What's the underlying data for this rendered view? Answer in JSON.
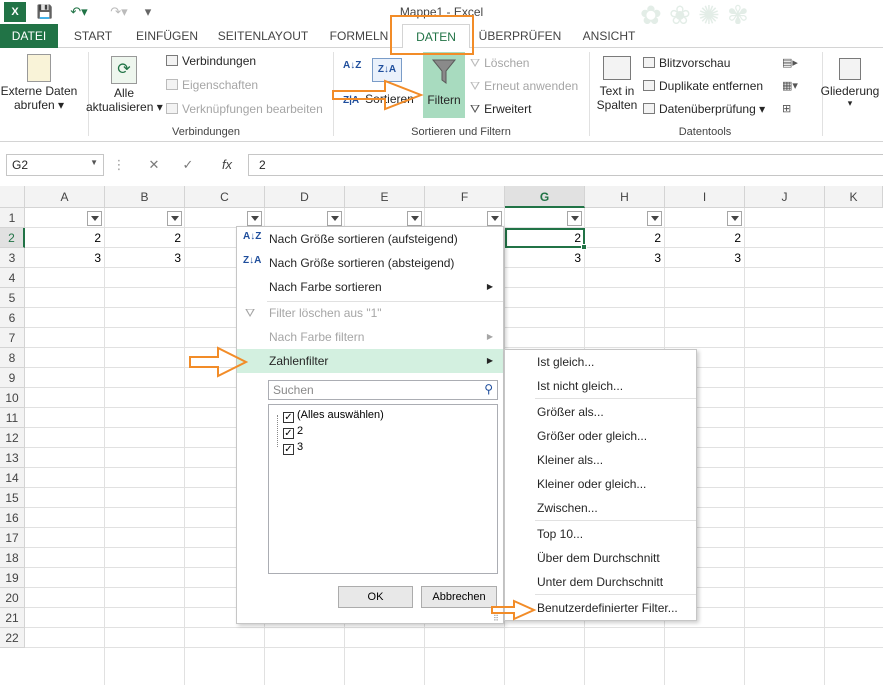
{
  "window": {
    "title": "Mappe1 - Excel"
  },
  "tabs": [
    {
      "label": "DATEI"
    },
    {
      "label": "START"
    },
    {
      "label": "EINFÜGEN"
    },
    {
      "label": "SEITENLAYOUT"
    },
    {
      "label": "FORMELN"
    },
    {
      "label": "DATEN"
    },
    {
      "label": "ÜBERPRÜFEN"
    },
    {
      "label": "ANSICHT"
    }
  ],
  "ribbon": {
    "externe_daten_line1": "Externe Daten",
    "externe_daten_line2": "abrufen ▾",
    "alle_line1": "Alle",
    "alle_line2": "aktualisieren ▾",
    "verbindungen": "Verbindungen",
    "eigenschaften": "Eigenschaften",
    "verknuepfungen": "Verknüpfungen bearbeiten",
    "group_verbindungen": "Verbindungen",
    "sort_az": "A↓Z",
    "sort_za": "Z↓A",
    "sortieren": "Sortieren",
    "filtern": "Filtern",
    "loeschen": "Löschen",
    "erneut": "Erneut anwenden",
    "erweitert": "Erweitert",
    "group_sortieren": "Sortieren und Filtern",
    "text_line1": "Text in",
    "text_line2": "Spalten",
    "blitz": "Blitzvorschau",
    "duplikate": "Duplikate entfernen",
    "datenueberpruefung": "Datenüberprüfung ▾",
    "group_datentools": "Datentools",
    "gliederung": "Gliederung"
  },
  "formula_bar": {
    "name_box": "G2",
    "value": "2",
    "fx": "fx",
    "cancel": "✕",
    "enter": "✓"
  },
  "columns": [
    "A",
    "B",
    "C",
    "D",
    "E",
    "F",
    "G",
    "H",
    "I",
    "J",
    "K"
  ],
  "rows": [
    "1",
    "2",
    "3",
    "4",
    "5",
    "6",
    "7",
    "8",
    "9",
    "10",
    "11",
    "12",
    "13",
    "14",
    "15",
    "16",
    "17",
    "18",
    "19",
    "20",
    "21",
    "22"
  ],
  "cells": {
    "row2": [
      "2",
      "2",
      "2",
      "2",
      "2"
    ],
    "row3": [
      "3",
      "3",
      "3",
      "3",
      "3"
    ]
  },
  "menu": {
    "sort_asc": "Nach Größe sortieren (aufsteigend)",
    "sort_desc": "Nach Größe sortieren (absteigend)",
    "sort_color": "Nach Farbe sortieren",
    "clear_filter": "Filter löschen aus \"1\"",
    "filter_color": "Nach Farbe filtern",
    "number_filter": "Zahlenfilter",
    "search_placeholder": "Suchen",
    "select_all": "(Alles auswählen)",
    "item_2": "2",
    "item_3": "3",
    "ok": "OK",
    "cancel": "Abbrechen"
  },
  "submenu": {
    "items": [
      "Ist gleich...",
      "Ist nicht gleich...",
      "Größer als...",
      "Größer oder gleich...",
      "Kleiner als...",
      "Kleiner oder gleich...",
      "Zwischen...",
      "Top 10...",
      "Über dem Durchschnitt",
      "Unter dem Durchschnitt",
      "Benutzerdefinierter Filter..."
    ]
  },
  "colors": {
    "accent": "#217346",
    "annotation": "#f28c28",
    "highlight": "#d3f0e0"
  }
}
